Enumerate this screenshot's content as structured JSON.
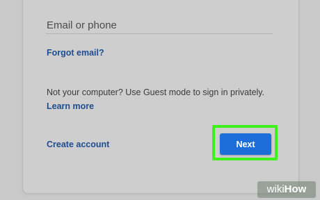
{
  "signin": {
    "email_placeholder": "Email or phone",
    "email_value": "",
    "forgot_email": "Forgot email?",
    "guest_notice": "Not your computer? Use Guest mode to sign in privately.",
    "learn_more": "Learn more",
    "create_account": "Create account",
    "next_label": "Next"
  },
  "watermark": {
    "part1": "wiki",
    "part2": "How"
  },
  "colors": {
    "link": "#1d4d8f",
    "primary_button": "#1c6fd9",
    "highlight": "#3ef01c"
  }
}
